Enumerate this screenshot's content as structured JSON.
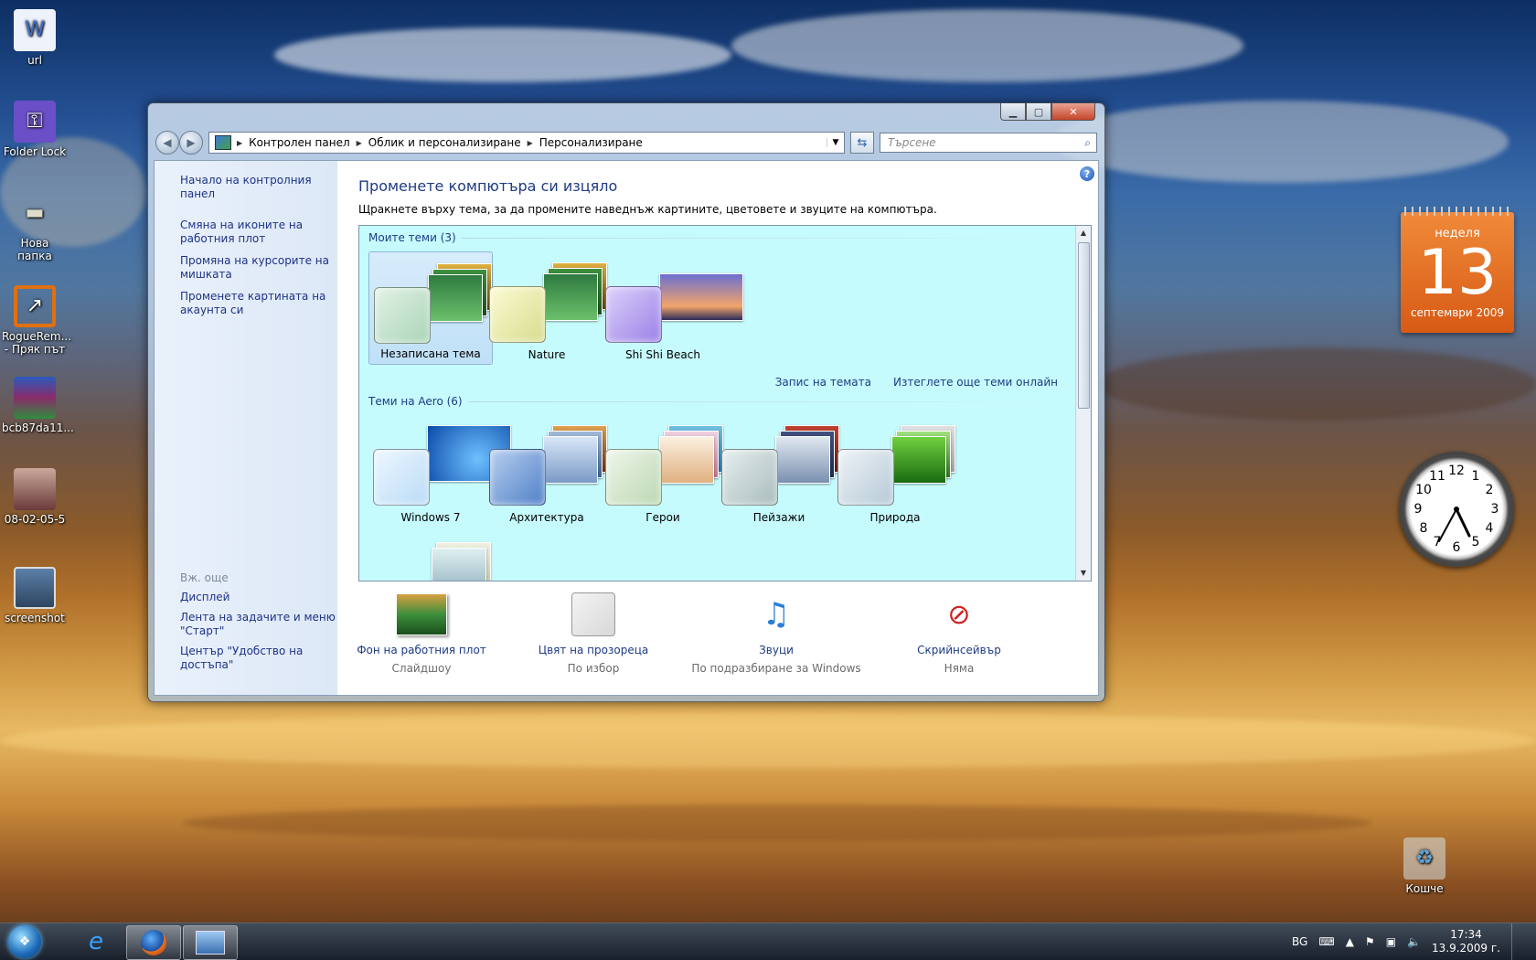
{
  "desktop": {
    "icons": [
      {
        "label": "url",
        "icon": "word-document-icon",
        "color": "#3b6fd1"
      },
      {
        "label": "Folder Lock",
        "icon": "folder-lock-icon",
        "color": "#6a4fc8"
      },
      {
        "label": "Нова папка",
        "icon": "tank-icon",
        "color": "#6d6d55"
      },
      {
        "label": "RogueRem... - Пряк път",
        "icon": "shortcut-icon",
        "color": "#e07010"
      },
      {
        "label": "bcb87da11...",
        "icon": "winrar-icon",
        "color": "#8a2b6b"
      },
      {
        "label": "08-02-05-5",
        "icon": "photo-icon",
        "color": "#a04040"
      },
      {
        "label": "screenshot",
        "icon": "screenshot-icon",
        "color": "#446688"
      }
    ],
    "recycle_bin": "Кошче"
  },
  "window": {
    "breadcrumb": [
      "Контролен панел",
      "Облик и персонализиране",
      "Персонализиране"
    ],
    "search_placeholder": "Търсене",
    "help": "?",
    "left": {
      "home": "Начало на контролния панел",
      "tasks": [
        "Смяна на иконите на работния плот",
        "Промяна на курсорите на мишката",
        "Променете картината на акаунта си"
      ],
      "see_also_header": "Вж. още",
      "see_also": [
        "Дисплей",
        "Лента на задачите и меню \"Старт\"",
        "Център \"Удобство на достъпа\""
      ]
    },
    "title": "Променете компютъра си изцяло",
    "description": "Щракнете върху тема, за да промените наведнъж картините, цветовете и звуците на компютъра.",
    "my_themes_header": "Моите теми (3)",
    "my_themes": [
      {
        "name": "Незаписана тема",
        "swatch": "#bfe3c8",
        "selected": true
      },
      {
        "name": "Nature",
        "swatch": "#e8ecaa",
        "selected": false
      },
      {
        "name": "Shi Shi Beach",
        "swatch": "#b9a2ef",
        "selected": false
      }
    ],
    "save_theme": "Запис на темата",
    "get_more": "Изтеглете още теми онлайн",
    "aero_header": "Теми на Aero (6)",
    "aero_themes": [
      {
        "name": "Windows 7",
        "swatch": "#cfe8fb"
      },
      {
        "name": "Архитектура",
        "swatch": "#7fa7dd"
      },
      {
        "name": "Герои",
        "swatch": "#d8ead2"
      },
      {
        "name": "Пейзажи",
        "swatch": "#c5d4d4"
      },
      {
        "name": "Природа",
        "swatch": "#cfdde6"
      }
    ],
    "bottom": [
      {
        "name": "Фон на работния плот",
        "sub": "Слайдшоу"
      },
      {
        "name": "Цвят на прозореца",
        "sub": "По избор"
      },
      {
        "name": "Звуци",
        "sub": "По подразбиране за Windows"
      },
      {
        "name": "Скрийнсейвър",
        "sub": "Няма"
      }
    ]
  },
  "calendar": {
    "dow": "неделя",
    "day": "13",
    "month": "септември 2009"
  },
  "clock_numbers": [
    "12",
    "1",
    "2",
    "3",
    "4",
    "5",
    "6",
    "7",
    "8",
    "9",
    "10",
    "11"
  ],
  "tray": {
    "lang": "BG",
    "time": "17:34",
    "date": "13.9.2009 г."
  }
}
